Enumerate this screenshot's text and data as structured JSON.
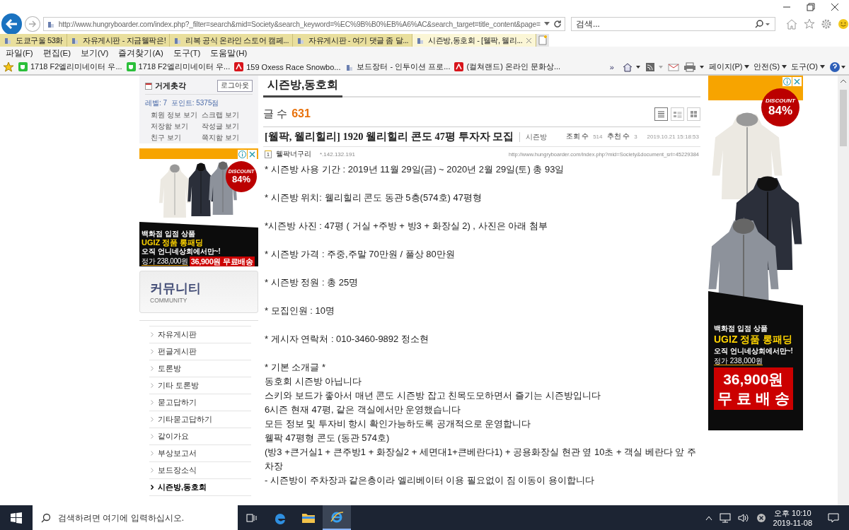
{
  "browser": {
    "url": "http://www.hungryboarder.com/index.php?_filter=search&mid=Society&search_keyword=%EC%9B%B0%EB%A6%AC&search_target=title_content&page=",
    "search": {
      "placeholder": "검색..."
    },
    "tabs": [
      {
        "label": "도쿄구울 53화",
        "selected": false
      },
      {
        "label": "자유게시판 - 지금웰팍은!",
        "selected": false
      },
      {
        "label": "리복 공식 온라인 스토어 캠페...",
        "selected": false
      },
      {
        "label": "자유게시판 - 여기 댓글 좀 달...",
        "selected": false
      },
      {
        "label": "시즌방,동호회 - [웰팍, 웰리...",
        "selected": true
      }
    ],
    "menu": [
      "파일(F)",
      "편집(E)",
      "보기(V)",
      "즐겨찾기(A)",
      "도구(T)",
      "도움말(H)"
    ],
    "favorites": [
      {
        "label": "1718 F2엘리미네이터 우...",
        "kind": "green"
      },
      {
        "label": "1718 F2엘리미네이터 우...",
        "kind": "green"
      },
      {
        "label": "159 Oxess Race Snowbo...",
        "kind": "red"
      },
      {
        "label": "보드장터 - 인투이션 프로...",
        "kind": "site"
      },
      {
        "label": "(컬쳐랜드) 온라인 문화상...",
        "kind": "red"
      }
    ],
    "more": "»",
    "commands": [
      "페이지(P)",
      "안전(S)",
      "도구(O)"
    ]
  },
  "sidebar": {
    "user": "거게촛각",
    "logout": "로그아웃",
    "level": "레벨: 7",
    "points": "포인트: 5375점",
    "links": [
      "회원 정보 보기",
      "스크랩 보기",
      "저장함 보기",
      "작성글 보기",
      "친구 보기",
      "쪽지함 보기"
    ],
    "banner": {
      "title": "커뮤니티",
      "subtitle": "COMMUNITY"
    },
    "items": [
      {
        "label": "자유게시판",
        "selected": false
      },
      {
        "label": "펀글게시판",
        "selected": false
      },
      {
        "label": "토론방",
        "selected": false
      },
      {
        "label": "기타 토론방",
        "selected": false
      },
      {
        "label": "묻고답하기",
        "selected": false
      },
      {
        "label": "기타묻고답하기",
        "selected": false
      },
      {
        "label": "같이가요",
        "selected": false
      },
      {
        "label": "부상보고서",
        "selected": false
      },
      {
        "label": "보드장소식",
        "selected": false
      },
      {
        "label": "시즌방,동호회",
        "selected": true
      }
    ]
  },
  "ads": [
    {
      "kind": "wide",
      "discount_label": "DISCOUNT",
      "discount": "84%",
      "line1": "백화점 입점 상품",
      "line2": "UGIZ 정품 롱패딩",
      "line3": "오직 언니네상회에서만~!",
      "old_price": "정가 238,000원",
      "price": "36,900원",
      "shipping": "무료배송"
    },
    {
      "kind": "tall",
      "discount_label": "DISCOUNT",
      "discount": "84%",
      "line1": "백화점 입점 상품",
      "line2": "UGIZ 정품 롱패딩",
      "line3": "오직 언니네상회에서만~!",
      "old_price": "정가 238,000원",
      "price": "36,900원",
      "shipping": "무 료 배 송"
    }
  ],
  "board": {
    "title": "시즌방,동호회",
    "count_label": "글 수",
    "count": "631",
    "views": [
      {
        "kind": "list",
        "selected": true
      },
      {
        "kind": "webzine",
        "selected": false
      },
      {
        "kind": "gallery",
        "selected": false
      }
    ],
    "post": {
      "title": "[웰팍, 웰리힐리] 1920 웰리힐리 콘도 47평 투자자 모집",
      "category": "시즌방",
      "views_label": "조회 수",
      "views": "514",
      "likes_label": "추천 수",
      "likes": "3",
      "date": "2019.10.21 15:18:53",
      "level": "1",
      "author": "웰팍너구리",
      "ip": "*.142.132.191",
      "link": "http://www.hungryboarder.com/index.php?mid=Society&document_srl=45229384",
      "blocks": [
        [
          "* 시즌방 사용 기간 : 2019년 11월 29일(금) ~ 2020년 2월 29일(토) 총 93일"
        ],
        [
          "* 시즌방 위치: 웰리힐리 콘도 동관 5층(574호) 47평형"
        ],
        [
          "*시즌방 사진 : 47평 ( 거실 +주방 + 방3 + 화장실 2) , 사진은 아래 첨부"
        ],
        [
          "* 시즌방 가격 : 주중,주말 70만원 / 풀상 80만원"
        ],
        [
          "* 시즌방 정원 : 총 25명"
        ],
        [
          "* 모집인원 : 10명"
        ],
        [
          "* 게시자 연락처 : 010-3460-9892 정소현"
        ],
        [
          "* 기본 소개글 *",
          "동호회 시즌방 아닙니다",
          "스키와 보드가 좋아서 매년 콘도 시즌방 잡고 친목도모하면서 즐기는 시즌방입니다",
          "6시즌 현재 47평, 같은 객실에서만 운영했습니다",
          "모든 정보 및 투자비 항시 확인가능하도록 공개적으로 운영합니다",
          "웰팍 47평형 콘도 (동관 574호)",
          "(방3 +큰거실1 + 큰주방1 + 화장실2 + 세면대1+큰베란다1) + 공용화장실 현관 옆 10초 + 객실 베란다 앞 주차장",
          "- 시즌방이 주차장과 같은층이라 엘리베이터 이용 필요없이 짐 이동이 용이합니다"
        ]
      ]
    }
  },
  "taskbar": {
    "search": {
      "placeholder": "검색하려면 여기에 입력하십시오."
    },
    "time": "오후 10:10",
    "date": "2019-11-08"
  }
}
